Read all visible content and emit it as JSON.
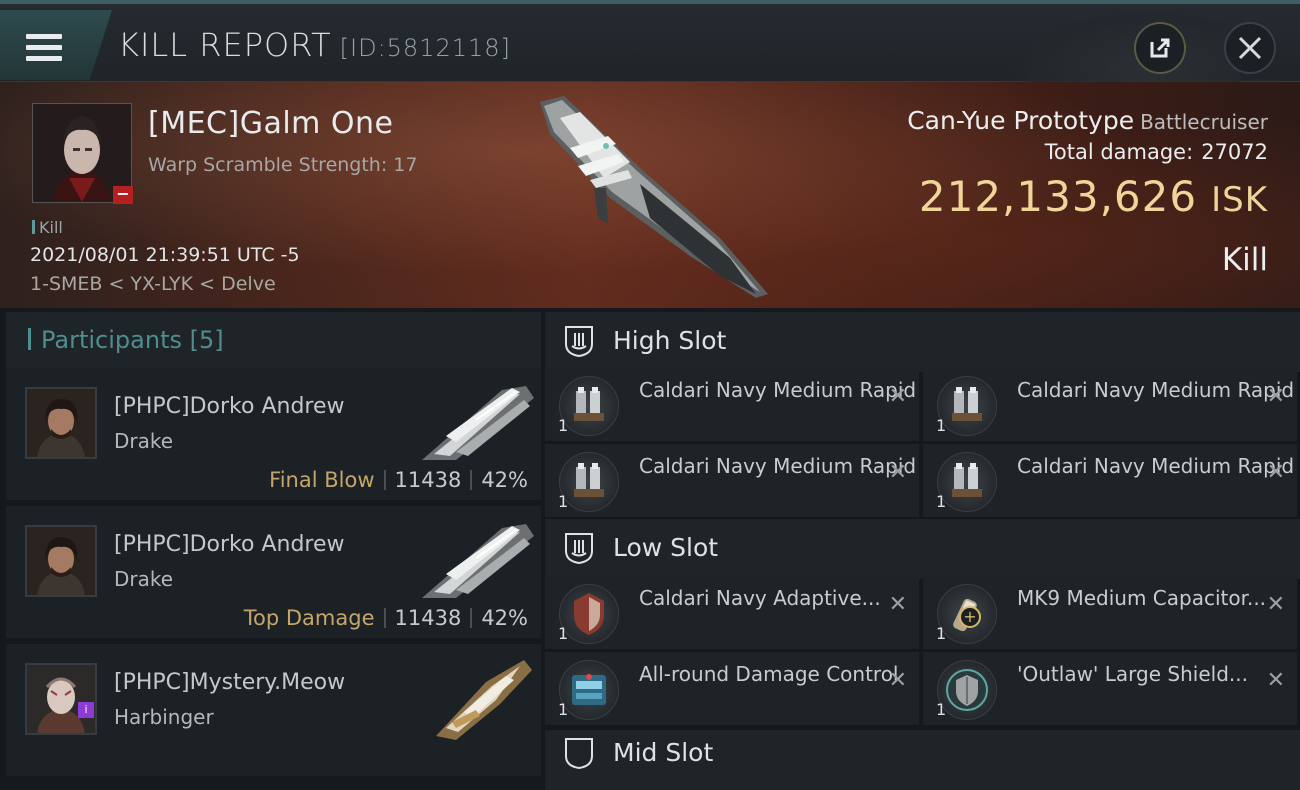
{
  "header": {
    "title": "KILL REPORT",
    "id": "[ID:5812118]"
  },
  "victim": {
    "name": "[MEC]Galm One",
    "warp_scramble": "Warp Scramble Strength: 17",
    "tag": "Kill",
    "datetime": "2021/08/01 21:39:51 UTC -5",
    "location": "1-SMEB < YX-LYK < Delve",
    "ship_name": "Can-Yue Prototype",
    "ship_class": "Battlecruiser",
    "total_damage_label": "Total damage:",
    "total_damage": "27072",
    "isk_value": "212,133,626",
    "isk_unit": "ISK",
    "result": "Kill"
  },
  "participants": {
    "label": "Participants",
    "count": "[5]",
    "rows": [
      {
        "name": "[PHPC]Dorko Andrew",
        "ship": "Drake",
        "role": "Final Blow",
        "damage": "11438",
        "percent": "42%"
      },
      {
        "name": "[PHPC]Dorko Andrew",
        "ship": "Drake",
        "role": "Top Damage",
        "damage": "11438",
        "percent": "42%"
      },
      {
        "name": "[PHPC]Mystery.Meow",
        "ship": "Harbinger",
        "role": "",
        "damage": "",
        "percent": ""
      }
    ]
  },
  "slots": {
    "high": {
      "label": "High Slot",
      "modules": [
        {
          "name": "Caldari Navy Medium Rapid ...",
          "qty": "1"
        },
        {
          "name": "Caldari Navy Medium Rapid ...",
          "qty": "1"
        },
        {
          "name": "Caldari Navy Medium Rapid ...",
          "qty": "1"
        },
        {
          "name": "Caldari Navy Medium Rapid ...",
          "qty": "1"
        }
      ]
    },
    "low": {
      "label": "Low Slot",
      "modules": [
        {
          "name": "Caldari Navy Adaptive...",
          "qty": "1"
        },
        {
          "name": "MK9 Medium Capacitor...",
          "qty": "1"
        },
        {
          "name": "All-round Damage Control",
          "qty": "1"
        },
        {
          "name": "'Outlaw' Large Shield...",
          "qty": "1"
        }
      ]
    },
    "mid": {
      "label": "Mid Slot"
    }
  },
  "colors": {
    "accent": "#4f8d90",
    "isk": "#efd59a",
    "role": "#c5a66a",
    "badge_red": "#b42020"
  }
}
